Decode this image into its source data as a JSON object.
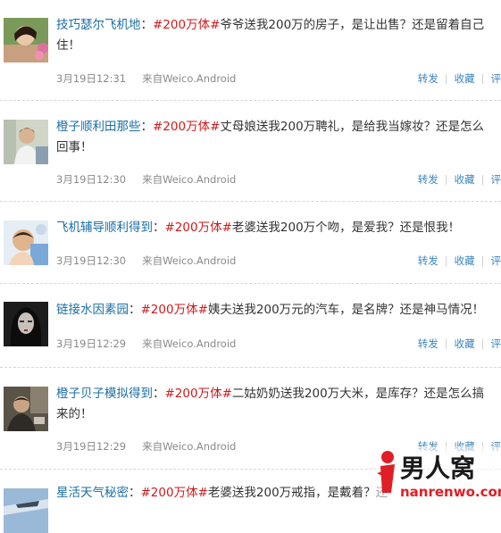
{
  "posts": [
    {
      "user": "技巧瑟尔飞机地",
      "tag": "#200万体#",
      "text": "爷爷送我200万的房子，是让出售？还是留着自己住！",
      "time": "3月19日12:31",
      "from_label": "来自",
      "source": "Weico.Android",
      "actions": [
        "转发",
        "收藏",
        "评"
      ]
    },
    {
      "user": "橙子顺利田那些",
      "tag": "#200万体#",
      "text": "丈母娘送我200万聘礼，是给我当嫁妆？还是怎么回事！",
      "time": "3月19日12:30",
      "from_label": "来自",
      "source": "Weico.Android",
      "actions": [
        "转发",
        "收藏",
        "评"
      ]
    },
    {
      "user": "飞机辅导顺利得到",
      "tag": "#200万体#",
      "text": "老婆送我200万个吻，是爱我？还是恨我！",
      "time": "3月19日12:30",
      "from_label": "来自",
      "source": "Weico.Android",
      "actions": [
        "转发",
        "收藏",
        "评"
      ]
    },
    {
      "user": "链接水因素园",
      "tag": "#200万体#",
      "text": "姨夫送我200万元的汽车，是名牌？还是神马情况！",
      "time": "3月19日12:29",
      "from_label": "来自",
      "source": "Weico.Android",
      "actions": [
        "转发",
        "收藏",
        "评"
      ]
    },
    {
      "user": "橙子贝子模拟得到",
      "tag": "#200万体#",
      "text": "二姑奶奶送我200万大米，是库存？还是怎么搞来的！",
      "time": "3月19日12:29",
      "from_label": "来自",
      "source": "Weico.Android",
      "actions": [
        "转发",
        "收藏",
        "评"
      ]
    },
    {
      "user": "星活天气秘密",
      "tag": "#200万体#",
      "text": "老婆送我200万戒指，是戴着？还",
      "time": "",
      "from_label": "",
      "source": "",
      "actions": []
    }
  ],
  "watermark": {
    "brand": "男人窝",
    "url": "nanrenwo.com"
  },
  "colors": {
    "user": "#1a6ea5",
    "tag": "#d0191b",
    "meta": "#8a8a8a",
    "action": "#3e86bd"
  }
}
